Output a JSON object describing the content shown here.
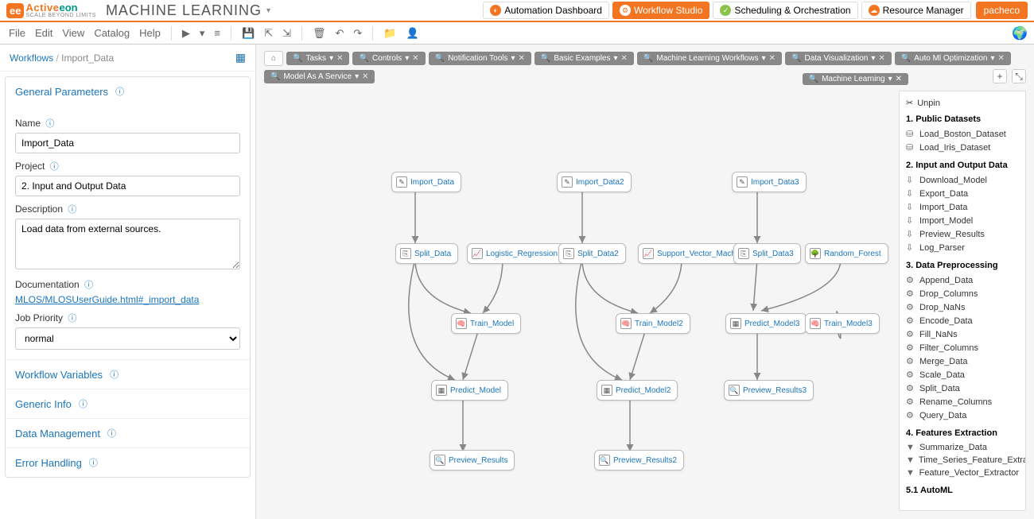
{
  "header": {
    "brand_main": "Active",
    "brand_sub": "eon",
    "brand_tag": "SCALE BEYOND LIMITS",
    "title": "MACHINE LEARNING",
    "buttons": {
      "automation": "Automation Dashboard",
      "workflow": "Workflow Studio",
      "scheduling": "Scheduling & Orchestration",
      "resource": "Resource Manager"
    },
    "user": "pacheco"
  },
  "menu": {
    "file": "File",
    "edit": "Edit",
    "view": "View",
    "catalog": "Catalog",
    "help": "Help"
  },
  "breadcrumb": {
    "root": "Workflows",
    "current": "Import_Data"
  },
  "tabs": [
    "Tasks",
    "Controls",
    "Notification Tools",
    "Basic Examples",
    "Machine Learning Workflows",
    "Data Visualization",
    "Auto Ml Optimization",
    "Model As A Service"
  ],
  "ml_tag": "Machine Learning",
  "params": {
    "section_general": "General Parameters",
    "name_label": "Name",
    "name_value": "Import_Data",
    "project_label": "Project",
    "project_value": "2. Input and Output Data",
    "desc_label": "Description",
    "desc_value": "Load data from external sources.",
    "doc_label": "Documentation",
    "doc_link": "MLOS/MLOSUserGuide.html#_import_data",
    "priority_label": "Job Priority",
    "priority_value": "normal",
    "section_vars": "Workflow Variables",
    "section_generic": "Generic Info",
    "section_data": "Data Management",
    "section_error": "Error Handling"
  },
  "nodes": {
    "import1": "Import_Data",
    "import2": "Import_Data2",
    "import3": "Import_Data3",
    "split1": "Split_Data",
    "split2": "Split_Data2",
    "split3": "Split_Data3",
    "logr": "Logistic_Regression",
    "svm": "Support_Vector_Machines",
    "rf": "Random_Forest",
    "train1": "Train_Model",
    "train2": "Train_Model2",
    "train3": "Train_Model3",
    "pred1": "Predict_Model",
    "pred2": "Predict_Model2",
    "pred3": "Predict_Model3",
    "prev1": "Preview_Results",
    "prev2": "Preview_Results2",
    "prev3": "Preview_Results3"
  },
  "palette": {
    "unpin": "Unpin",
    "sec1": "1. Public Datasets",
    "sec1_items": [
      "Load_Boston_Dataset",
      "Load_Iris_Dataset"
    ],
    "sec2": "2. Input and Output Data",
    "sec2_items": [
      "Download_Model",
      "Export_Data",
      "Import_Data",
      "Import_Model",
      "Preview_Results",
      "Log_Parser"
    ],
    "sec3": "3. Data Preprocessing",
    "sec3_items": [
      "Append_Data",
      "Drop_Columns",
      "Drop_NaNs",
      "Encode_Data",
      "Fill_NaNs",
      "Filter_Columns",
      "Merge_Data",
      "Scale_Data",
      "Split_Data",
      "Rename_Columns",
      "Query_Data"
    ],
    "sec4": "4. Features Extraction",
    "sec4_items": [
      "Summarize_Data",
      "Time_Series_Feature_Extraction",
      "Feature_Vector_Extractor"
    ],
    "sec5": "5.1 AutoML"
  }
}
